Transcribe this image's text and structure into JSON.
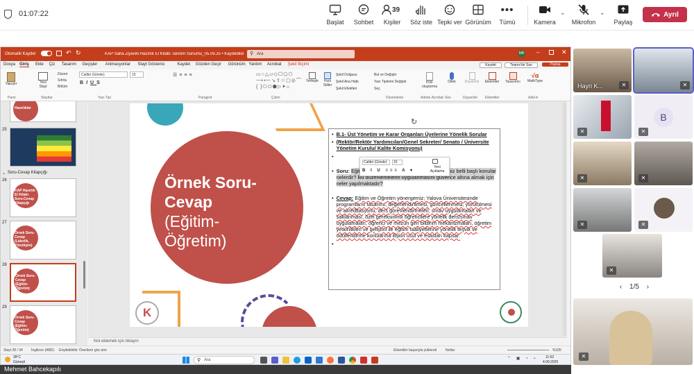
{
  "meeting": {
    "timer": "01:07:22",
    "toolbar": [
      {
        "label": "Başlat",
        "icon": "share-screen-icon"
      },
      {
        "label": "Sohbet",
        "icon": "chat-icon"
      },
      {
        "label": "Kişiler",
        "icon": "people-icon",
        "badge": "39"
      },
      {
        "label": "Söz iste",
        "icon": "raise-hand-icon"
      },
      {
        "label": "Tepki ver",
        "icon": "react-icon"
      },
      {
        "label": "Görünüm",
        "icon": "view-icon"
      },
      {
        "label": "Tümü",
        "icon": "more-icon"
      },
      {
        "label": "Kamera",
        "icon": "camera-icon"
      },
      {
        "label": "Mikrofon",
        "icon": "mic-muted-icon"
      },
      {
        "label": "Paylaş",
        "icon": "share-icon"
      }
    ],
    "leave_label": "Ayrıl",
    "pagination": "1/5",
    "presenter_name": "Mehmet Bahcekapılı",
    "participants": [
      {
        "name": "Hayri K..."
      },
      {
        "name": ""
      },
      {
        "name": ""
      },
      {
        "name": "B"
      },
      {
        "name": ""
      },
      {
        "name": ""
      },
      {
        "name": ""
      },
      {
        "name": ""
      },
      {
        "name": ""
      },
      {
        "name": ""
      }
    ]
  },
  "ppt": {
    "autosave": "Otomatik Kaydet",
    "file_title": "KAP Saha Ziyareti Hazırlık El Kitabı Tanıtım Sunumu_05.09.25 • Kaydedildi",
    "search_placeholder": "Ara",
    "user_initials": "MB",
    "menu": [
      "Dosya",
      "Giriş",
      "Ekle",
      "Çiz",
      "Tasarım",
      "Geçişler",
      "Animasyonlar",
      "Slayt Gösterisi",
      "Kaydet",
      "Gözden Geçir",
      "Görünüm",
      "Yardım",
      "Acrobat",
      "Şekil Biçimi"
    ],
    "menu_right": [
      "Kaydet",
      "Teams'de San",
      "Paylaş"
    ],
    "ribbon_groups": [
      "Pano",
      "Slaytlar",
      "Yazı Tipi",
      "Paragraf",
      "Çizim",
      "Düzenleme",
      "Adobe Acrobat",
      "Ses",
      "Duyarlılık",
      "Eklentiler",
      "Add-in"
    ],
    "ribbon_items": {
      "paste": "Yapıştır",
      "new_slide": "Yeni Slayt",
      "reuse": "Slaytları Yeniden Kullan",
      "layout": "Düzen",
      "reset": "Sıfırla",
      "section": "Bölüm",
      "font": "Calibri (Gövde)",
      "size": "15",
      "arrange": "Yerleştir",
      "quick_styles": "Hızlı Stiller",
      "fill": "Şekil Dolgusu",
      "outline": "Şekil Ana Hattı",
      "effects": "Şekil Efektleri",
      "find": "Bul ve Değiştir",
      "find_replace": "Yazı Tiplerini Değiştir",
      "select": "Seç",
      "pdf": "PDF oluşturma",
      "dictate": "Dikte",
      "sensitivity": "Duyarlılık",
      "addins": "Eklentiler",
      "designer": "Tasarımcı",
      "mathtype": "MathType"
    },
    "section_label": "Soru-Cevap Kitapçığı",
    "thumbnails": [
      {
        "num": "",
        "text": "Hazırlıklar"
      },
      {
        "num": "25",
        "text": ""
      },
      {
        "num": "26",
        "text": "KAP Hazırlık El Kitabı Soru-Cevap Kitapçığı"
      },
      {
        "num": "27",
        "text": "Örnek Soru-Cevap (Liderlik, Yönetişim)"
      },
      {
        "num": "28",
        "text": "Örnek Soru-Cevap (Eğitim-Öğretim)"
      },
      {
        "num": "29",
        "text": "Örnek Soru-Cevap (Eğitim-Öğretim)"
      }
    ],
    "slide": {
      "circle_title": "Örnek Soru-Cevap",
      "circle_subtitle": "(Eğitim-Öğretim)",
      "heading": "B.1- Üst Yönetim ve Karar Organları Üyelerine Yönelik Sorular",
      "subheading": "(Rektör/Rektör Yardımcıları/Genel Sekreter/ Senato / Üniversite Yönetim Kurulu/ Kalite Komisyonu)",
      "q_label": "Soru:",
      "question": "Eğitim ve öğretim yönergesiyle düzenlediğiniz belli başlı konular nelerdir? Bu düzenlemelerin uygulanmasını güvence altına almak için neler yapılmaktadır?",
      "a_label": "Cevap:",
      "answer": "Eğitim ve Öğretim yönergemiz; Yalova Üniversitesinde programların tasarımı, değerlendirilmesi, güncellenmesi, yürütülmesi ve akreditasyonu, ders görevlendirmeleri, sınav uygulamaları ve saklanması, özel gereksinimli öğrencilere yönelik ders/sınav uygulamaları, öğrenci ve mezun geri bildirim mekanizmaları, öğretim yetkinlikleri ve gelişimi ile eğitim faaliyetlerine yönelik teşvik ve ödüllendirme konularına ilişkin usul ve esasları kapsar.",
      "mini_font": "Calibri (Gövde)",
      "mini_size": "15",
      "mini_new": "Yeni Açıklama"
    },
    "notes_placeholder": "Not eklemek için tıklayın",
    "status_left": "Slayt 28 / 34",
    "status_lang": "İngilizce (ABD)",
    "status_access": "Erişilebilirlik: Önerilere göz atın",
    "status_center": "Eklentiler başarıyla yüklendi",
    "status_notes": "Notlar",
    "zoom": "%105",
    "taskbar_search": "Ara",
    "weather_temp": "28°C",
    "weather_desc": "Güneşli",
    "clock_time": "11:52",
    "clock_date": "4.09.2025"
  }
}
